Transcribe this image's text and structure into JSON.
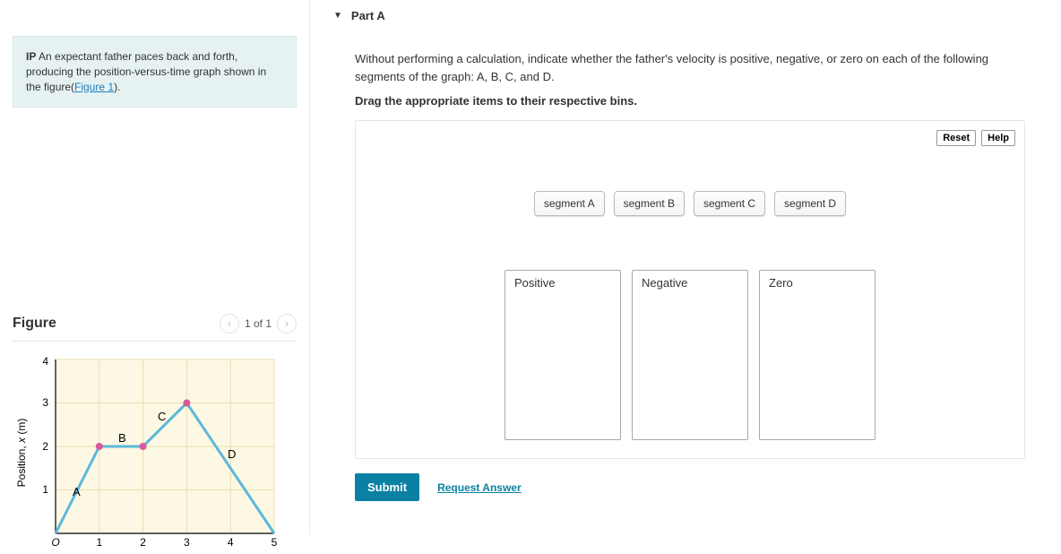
{
  "problem": {
    "ip_prefix": "IP",
    "text_before_link": " An expectant father paces back and forth, producing the position-versus-time graph shown in the figure(",
    "link_text": "Figure 1",
    "text_after_link": ")."
  },
  "figure": {
    "title": "Figure",
    "pager": "1 of 1"
  },
  "part": {
    "title": "Part A",
    "prompt": "Without performing a calculation, indicate whether the father's velocity is positive, negative, or zero on each of the following segments of the graph: A, B, C, and D.",
    "instruct": "Drag the appropriate items to their respective bins."
  },
  "toolbar": {
    "reset": "Reset",
    "help": "Help"
  },
  "segments": [
    "segment A",
    "segment B",
    "segment C",
    "segment D"
  ],
  "bins": [
    "Positive",
    "Negative",
    "Zero"
  ],
  "buttons": {
    "submit": "Submit",
    "request": "Request Answer"
  },
  "chart_data": {
    "type": "line",
    "title": "",
    "xlabel": "",
    "ylabel": "Position, x (m)",
    "xlim": [
      0,
      5
    ],
    "ylim": [
      0,
      4
    ],
    "x_ticks": [
      "O",
      "1",
      "2",
      "3",
      "4",
      "5"
    ],
    "y_ticks": [
      "1",
      "2",
      "3",
      "4"
    ],
    "series": [
      {
        "name": "path",
        "points": [
          [
            0,
            0
          ],
          [
            1,
            2
          ],
          [
            2,
            2
          ],
          [
            3,
            3
          ],
          [
            5,
            0
          ]
        ]
      }
    ],
    "point_markers": [
      [
        1,
        2
      ],
      [
        2,
        2
      ],
      [
        3,
        3
      ]
    ],
    "annotations": [
      {
        "label": "A",
        "x": 0.4,
        "y": 1.0
      },
      {
        "label": "B",
        "x": 1.5,
        "y": 2.15
      },
      {
        "label": "C",
        "x": 2.4,
        "y": 2.7
      },
      {
        "label": "D",
        "x": 3.7,
        "y": 1.9
      }
    ]
  }
}
